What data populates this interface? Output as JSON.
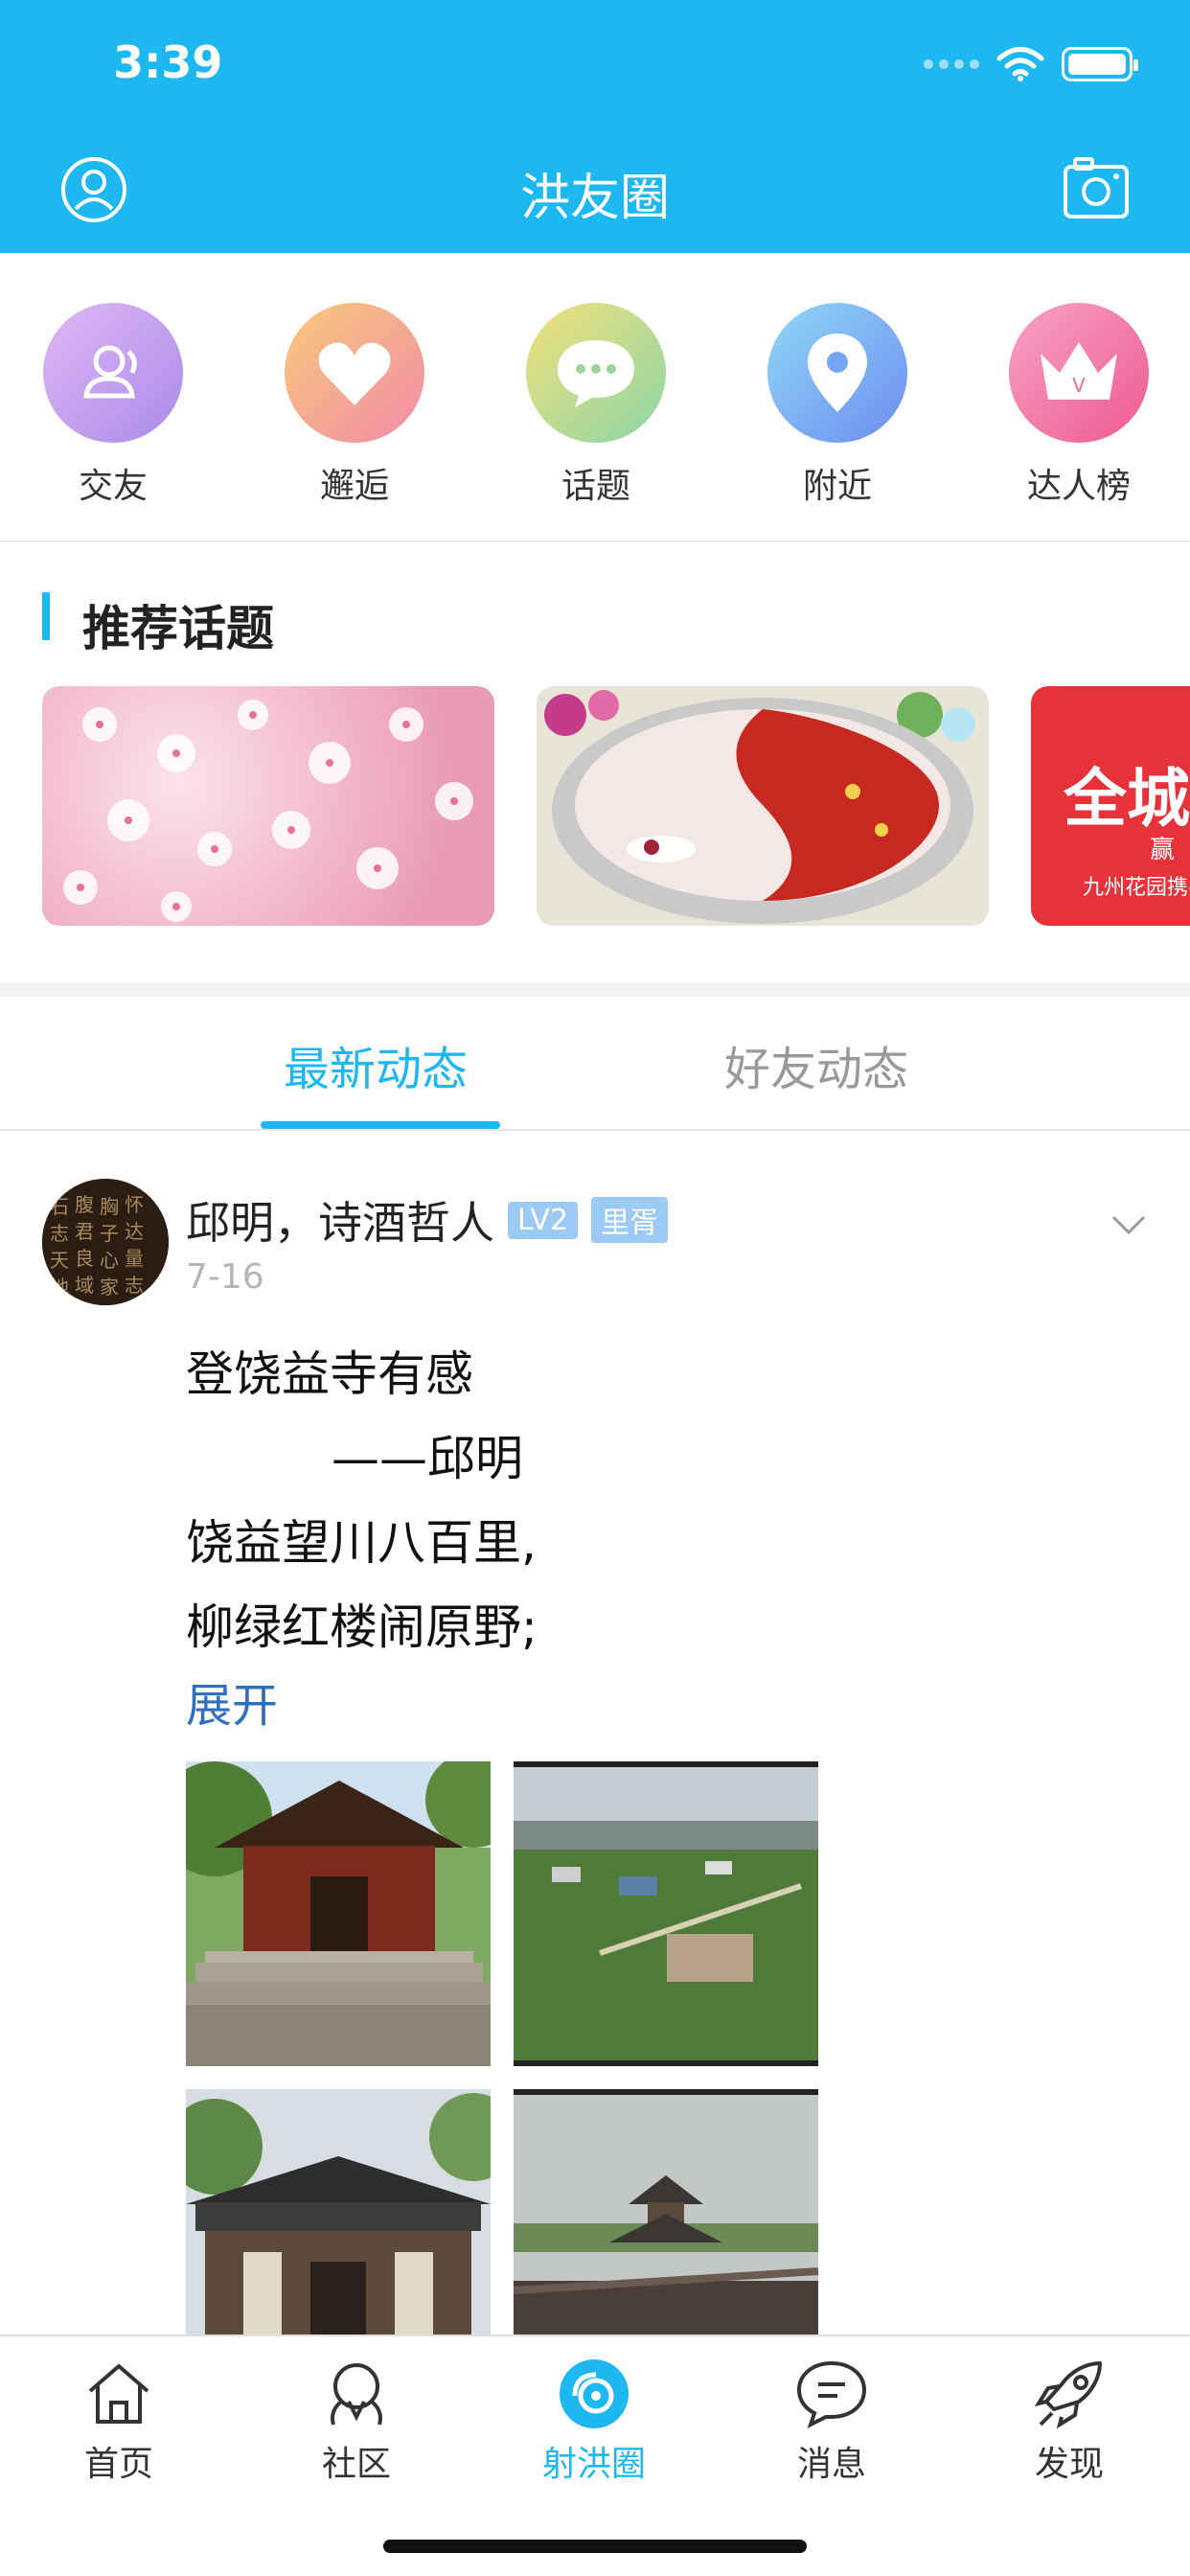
{
  "status_bar": {
    "time": "3:39"
  },
  "nav": {
    "title": "洪友圈",
    "left_icon": "user-icon",
    "right_icon": "camera-icon"
  },
  "quick_links": [
    {
      "label": "交友",
      "icon": "friends-icon",
      "color": "#C9A2F0"
    },
    {
      "label": "邂逅",
      "icon": "heart-icon",
      "color": "#F7A35C"
    },
    {
      "label": "话题",
      "icon": "chat-bubble-icon",
      "color": "#9AD67C"
    },
    {
      "label": "附近",
      "icon": "location-pin-icon",
      "color": "#6EA8F5"
    },
    {
      "label": "达人榜",
      "icon": "crown-icon",
      "color": "#F27AA9"
    }
  ],
  "recommended": {
    "title": "推荐话题",
    "cards": [
      {
        "image": "cherry-blossom-image"
      },
      {
        "image": "hotpot-image"
      },
      {
        "image": "promo-banner-image",
        "text_main": "全城",
        "text_side": "赢",
        "text_sub": "九州花园携手"
      }
    ]
  },
  "tabs": {
    "active": "最新动态",
    "inactive": "好友动态"
  },
  "post": {
    "author": "邱明，诗酒哲人",
    "badge_level": "LV2",
    "badge_area": "里胥",
    "date": "7-16",
    "lines": [
      "登饶益寺有感",
      "——邱明",
      "饶益望川八百里,",
      "柳绿红楼闹原野;"
    ],
    "expand_label": "展开",
    "photos": [
      "temple-gate-photo",
      "village-field-photo",
      "temple-hall-photo",
      "pagoda-roof-photo"
    ]
  },
  "tabbar": [
    {
      "label": "首页",
      "icon": "home-icon",
      "active": false
    },
    {
      "label": "社区",
      "icon": "community-icon",
      "active": false
    },
    {
      "label": "射洪圈",
      "icon": "circle-camera-icon",
      "active": true
    },
    {
      "label": "消息",
      "icon": "message-icon",
      "active": false
    },
    {
      "label": "发现",
      "icon": "rocket-icon",
      "active": false
    }
  ],
  "colors": {
    "brand": "#1DB8F2",
    "link": "#2F6FC0",
    "badge": "#9BCBF4"
  }
}
